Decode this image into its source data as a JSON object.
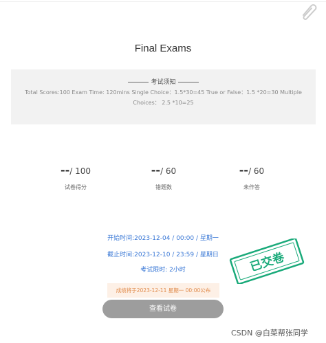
{
  "exam": {
    "title": "Final Exams",
    "notice_heading": "考试须知",
    "notice_text": "Total Scores:100 Exam Time: 120mins Single Choice：1.5*30=45 True or False：1.5 *20=30 Multiple Choices： 2.5 *10=25"
  },
  "stats": [
    {
      "value": "--",
      "total": "/ 100",
      "label": "试卷得分"
    },
    {
      "value": "--",
      "total": "/ 60",
      "label": "错题数"
    },
    {
      "value": "--",
      "total": "/ 60",
      "label": "未作答"
    }
  ],
  "schedule": {
    "start": "开始时间:2023-12-04 / 00:00 / 星期一",
    "end": "截止时间:2023-12-10 / 23:59 / 星期日",
    "limit": "考试限时: 2小时"
  },
  "publish_notice": "成绩将于2023-12-11 星期一 00:00公布",
  "submit_label": "查看试卷",
  "stamp_text": "已交卷",
  "watermark": "CSDN @白菜帮张同学",
  "colors": {
    "accent": "#3a78d6",
    "stamp": "#1aaa7a",
    "notice_orange": "#e08a4a",
    "button": "#9d9d9d"
  }
}
